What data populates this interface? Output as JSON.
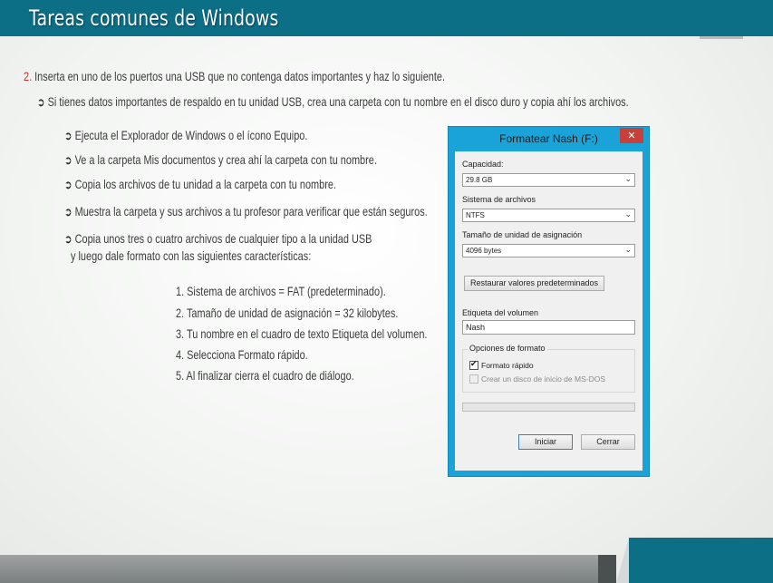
{
  "slide": {
    "title": "Tareas comunes de Windows",
    "step_number": "2.",
    "step_text": "Inserta en uno de los puertos una USB que no contenga datos importantes y haz lo siguiente.",
    "note": "Si tienes datos importantes de respaldo en tu unidad USB, crea una carpeta con tu nombre en el disco duro y copia ahí los archivos.",
    "bullets": [
      "Ejecuta el Explorador de Windows o el ícono Equipo.",
      "Ve a la carpeta Mis documentos y crea ahí la carpeta con tu nombre.",
      "Copia los archivos de tu unidad a la carpeta con tu nombre.",
      "Muestra la carpeta y sus archivos a tu profesor para verificar que están seguros.",
      "Copia unos tres o cuatro archivos de cualquier tipo a la unidad USB"
    ],
    "bullet_continuation": "y luego dale formato con las siguientes características:",
    "steps": [
      "1. Sistema de archivos = FAT (predeterminado).",
      "2. Tamaño de unidad de asignación = 32 kilobytes.",
      "3. Tu nombre en el cuadro de texto Etiqueta del volumen.",
      "4. Selecciona Formato rápido.",
      "5. Al finalizar cierra el cuadro de diálogo."
    ]
  },
  "dialog": {
    "title": "Formatear Nash (F:)",
    "close_glyph": "✕",
    "capacity_label": "Capacidad:",
    "capacity_value": "29.8 GB",
    "filesystem_label": "Sistema de archivos",
    "filesystem_value": "NTFS",
    "alloc_label": "Tamaño de unidad de asignación",
    "alloc_value": "4096 bytes",
    "restore_button": "Restaurar valores predeterminados",
    "volume_label": "Etiqueta del volumen",
    "volume_value": "Nash",
    "options_label": "Opciones de formato",
    "quick_format_label": "Formato rápido",
    "quick_format_checked": true,
    "msdos_label": "Crear un disco de inicio de MS-DOS",
    "msdos_checked": false,
    "progress": 0,
    "start_button": "Iniciar",
    "close_button": "Cerrar",
    "chevron": "⌄"
  },
  "colors": {
    "band": "#0d6f86",
    "dialog_frame": "#19a3d9",
    "close_red": "#c7413a",
    "step_red": "#c8302d"
  }
}
